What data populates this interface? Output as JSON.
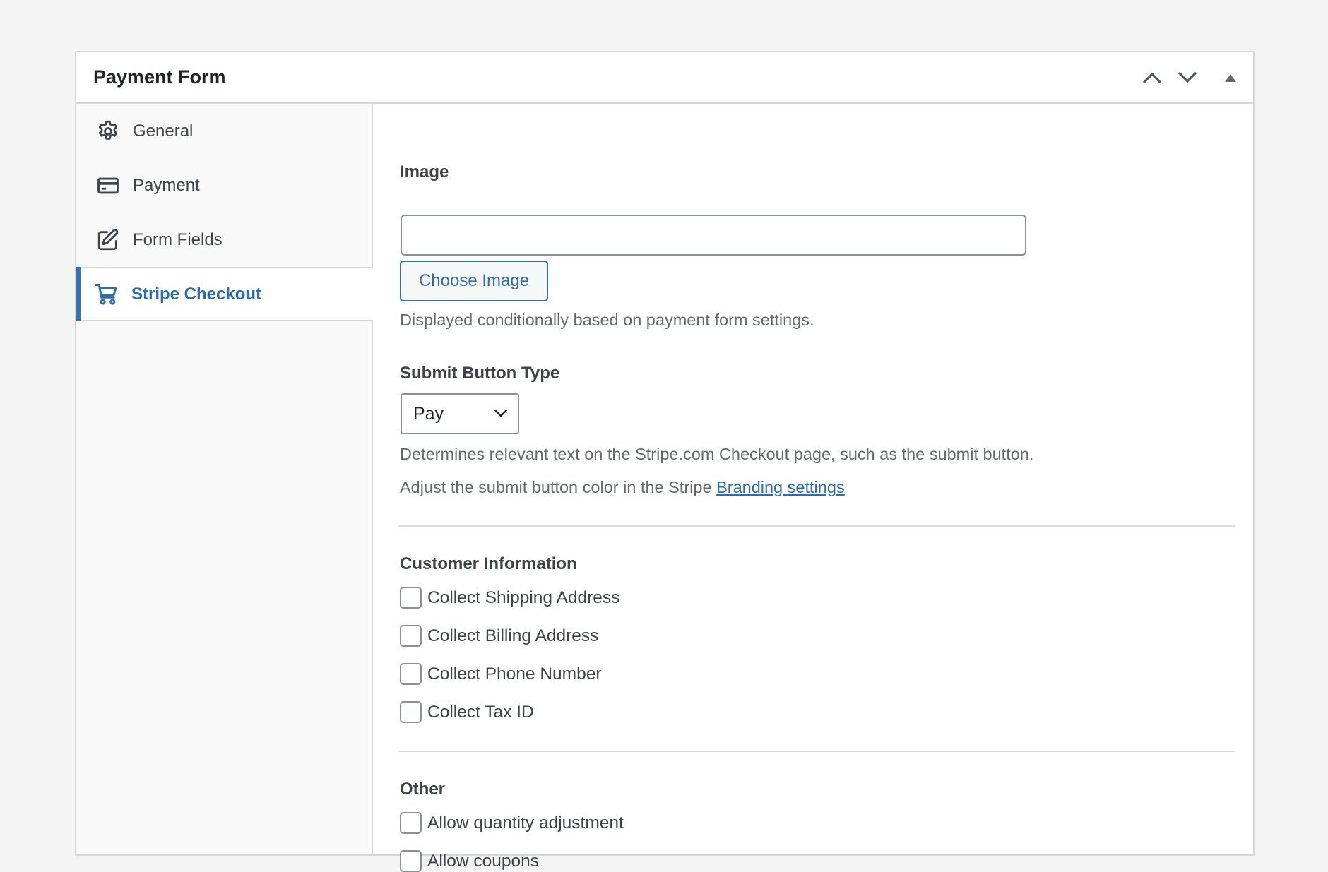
{
  "panel": {
    "title": "Payment Form",
    "header_controls": [
      {
        "name": "move-up",
        "icon": "chevron-up-icon"
      },
      {
        "name": "move-down",
        "icon": "chevron-down-icon"
      },
      {
        "name": "toggle-panel",
        "icon": "triangle-up-icon"
      }
    ]
  },
  "sidebar": {
    "tabs": [
      {
        "label": "General",
        "icon": "gear-icon",
        "active": false
      },
      {
        "label": "Payment",
        "icon": "credit-card-icon",
        "active": false
      },
      {
        "label": "Form Fields",
        "icon": "edit-icon",
        "active": false
      },
      {
        "label": "Stripe Checkout",
        "icon": "cart-icon",
        "active": true
      }
    ]
  },
  "colors": {
    "accent": "#3871b0",
    "link": "#2c6cb0",
    "text": "#3c434a",
    "help_text": "#646970",
    "border": "#d5d6d8",
    "background": "#f4f4f4"
  },
  "content": {
    "image": {
      "label": "Image",
      "value": "",
      "button_label": "Choose Image",
      "help": "Displayed conditionally based on payment form settings."
    },
    "submit_button_type": {
      "label": "Submit Button Type",
      "selected": "Pay",
      "help_1": "Determines relevant text on the Stripe.com Checkout page, such as the submit button.",
      "help_2_prefix": "Adjust the submit button color in the Stripe ",
      "help_2_link": "Branding settings"
    },
    "customer_information": {
      "heading": "Customer Information",
      "options": [
        {
          "label": "Collect Shipping Address",
          "checked": false
        },
        {
          "label": "Collect Billing Address",
          "checked": false
        },
        {
          "label": "Collect Phone Number",
          "checked": false
        },
        {
          "label": "Collect Tax ID",
          "checked": false
        }
      ]
    },
    "other": {
      "heading": "Other",
      "options": [
        {
          "label": "Allow quantity adjustment",
          "checked": false
        },
        {
          "label": "Allow coupons",
          "checked": false
        }
      ]
    }
  }
}
